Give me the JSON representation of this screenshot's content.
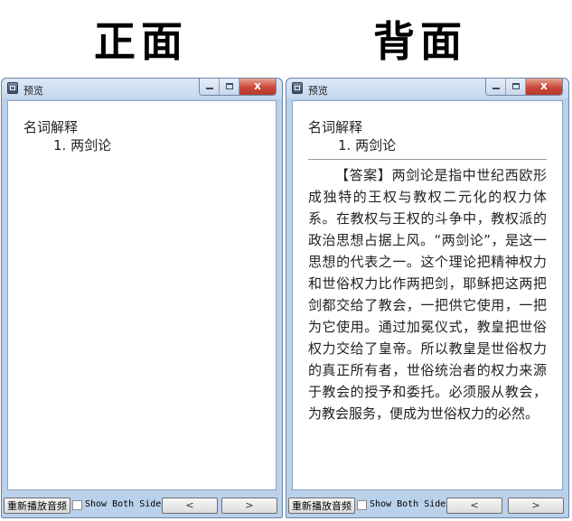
{
  "headings": {
    "front": "正面",
    "back": "背面"
  },
  "window": {
    "title": "预览",
    "close_symbol": "x"
  },
  "card": {
    "line1": "名词解释",
    "line2": "1. 两剑论",
    "answer": "【答案】两剑论是指中世纪西欧形成独特的王权与教权二元化的权力体系。在教权与王权的斗争中，教权派的政治思想占据上风。“两剑论”，是这一思想的代表之一。这个理论把精神权力和世俗权力比作两把剑，耶稣把这两把剑都交给了教会，一把供它使用，一把为它使用。通过加冕仪式，教皇把世俗权力交给了皇帝。所以教皇是世俗权力的真正所有者，世俗统治者的权力来源于教会的授予和委托。必须服从教会，为教会服务，便成为世俗权力的必然。"
  },
  "bottombar": {
    "replay_label": "重新播放音频",
    "show_both_label": "Show Both Sides",
    "show_both_checked": false,
    "prev_label": "<",
    "next_label": ">"
  },
  "colors": {
    "window_frame": "#b9d1ea",
    "close_button": "#c9473a"
  }
}
